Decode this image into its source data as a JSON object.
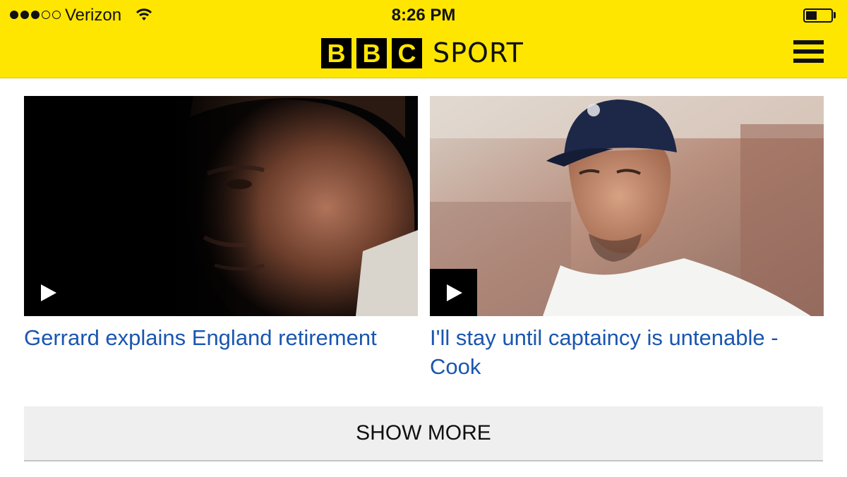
{
  "status_bar": {
    "signal": [
      "on",
      "on",
      "on",
      "off",
      "off"
    ],
    "carrier": "Verizon",
    "time": "8:26 PM",
    "battery_level": 0.45
  },
  "header": {
    "logo_letters": [
      "B",
      "B",
      "C"
    ],
    "logo_word": "SPORT",
    "menu_icon": "hamburger-menu-icon",
    "background": "#ffe600"
  },
  "stories": [
    {
      "headline": "Gerrard explains England retirement",
      "media_icon": "play-icon"
    },
    {
      "headline": "I'll stay until captaincy is untenable - Cook",
      "media_icon": "play-icon"
    }
  ],
  "show_more_label": "SHOW MORE",
  "colors": {
    "link": "#1a56b0",
    "brand_yellow": "#ffe600"
  }
}
